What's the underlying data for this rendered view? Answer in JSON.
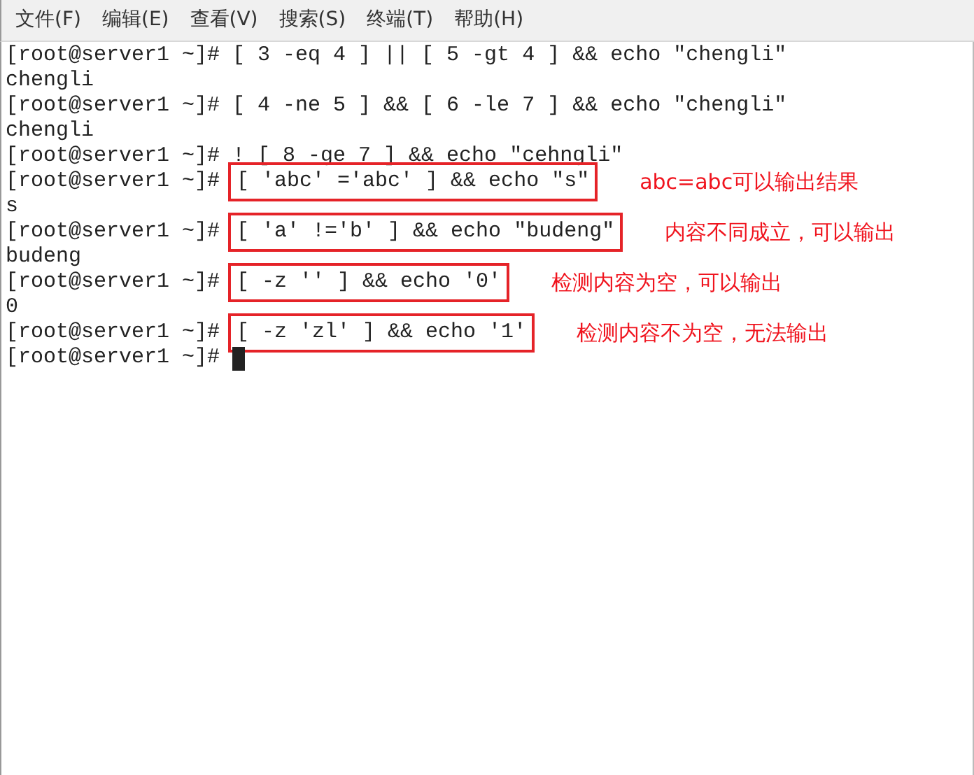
{
  "menu": [
    {
      "label": "文件(F)"
    },
    {
      "label": "编辑(E)"
    },
    {
      "label": "查看(V)"
    },
    {
      "label": "搜索(S)"
    },
    {
      "label": "终端(T)"
    },
    {
      "label": "帮助(H)"
    }
  ],
  "terminal": {
    "lines": [
      {
        "kind": "input",
        "prompt": "[root@server1 ~]#",
        "command": "[ 3 -eq 4 ] || [ 5 -gt 4 ] && echo \"chengli\"",
        "boxed": false
      },
      {
        "kind": "output",
        "text": "chengli"
      },
      {
        "kind": "input",
        "prompt": "[root@server1 ~]#",
        "command": "[ 4 -ne 5 ] && [ 6 -le 7 ] && echo \"chengli\"",
        "boxed": false
      },
      {
        "kind": "output",
        "text": "chengli"
      },
      {
        "kind": "input",
        "prompt": "[root@server1 ~]#",
        "command": "! [ 8 -ge 7 ] && echo \"cehngli\"",
        "boxed": false
      },
      {
        "kind": "input",
        "prompt": "[root@server1 ~]#",
        "command": "[ 'abc' ='abc' ] && echo \"s\"",
        "boxed": true,
        "note": "abc=abc可以输出结果"
      },
      {
        "kind": "output",
        "text": "s"
      },
      {
        "kind": "input",
        "prompt": "[root@server1 ~]#",
        "command": "[ 'a' !='b' ] && echo \"budeng\"",
        "boxed": true,
        "note": "内容不同成立，可以输出"
      },
      {
        "kind": "output",
        "text": "budeng"
      },
      {
        "kind": "input",
        "prompt": "[root@server1 ~]#",
        "command": "[ -z '' ] && echo '0'",
        "boxed": true,
        "note": "检测内容为空，可以输出"
      },
      {
        "kind": "output",
        "text": "0"
      },
      {
        "kind": "input",
        "prompt": "[root@server1 ~]#",
        "command": "[ -z 'zl' ] && echo '1'",
        "boxed": true,
        "note": "检测内容不为空，无法输出"
      },
      {
        "kind": "input",
        "prompt": "[root@server1 ~]#",
        "cursor": true
      }
    ]
  }
}
